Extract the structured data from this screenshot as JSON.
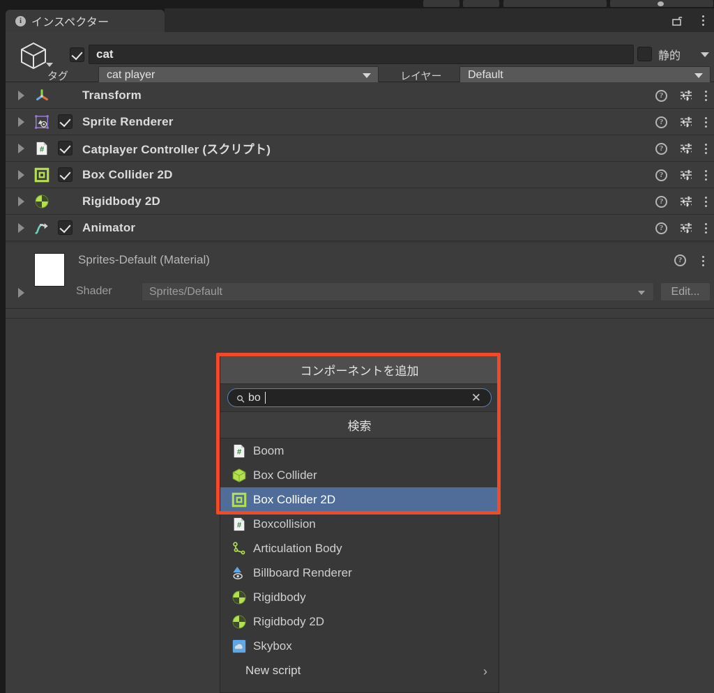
{
  "window": {
    "tab_label": "インスペクター",
    "tab_icon": "info-icon",
    "lock_icon": "lock-open-icon",
    "menu_icon": "kebab-menu-icon"
  },
  "game_object": {
    "enabled": true,
    "name": "cat",
    "icon": "cube-icon",
    "static_label": "静的",
    "static_checked": false,
    "tag_label": "タグ",
    "tag_value": "cat player",
    "layer_label": "レイヤー",
    "layer_value": "Default"
  },
  "components": [
    {
      "name": "Transform",
      "icon": "transform-axis-icon",
      "has_checkbox": false,
      "enabled": false
    },
    {
      "name": "Sprite Renderer",
      "icon": "sprite-renderer-icon",
      "has_checkbox": true,
      "enabled": true
    },
    {
      "name": "Catplayer Controller (スクリプト)",
      "icon": "cs-script-icon",
      "has_checkbox": true,
      "enabled": true
    },
    {
      "name": "Box Collider 2D",
      "icon": "box-collider-2d-icon",
      "has_checkbox": true,
      "enabled": true
    },
    {
      "name": "Rigidbody 2D",
      "icon": "rigidbody-2d-icon",
      "has_checkbox": false,
      "enabled": false
    },
    {
      "name": "Animator",
      "icon": "animator-icon",
      "has_checkbox": true,
      "enabled": true
    }
  ],
  "row_tools": {
    "help_label": "?",
    "help_icon": "help-icon",
    "settings_icon": "settings-sliders-icon",
    "menu_icon": "kebab-menu-icon"
  },
  "material": {
    "title": "Sprites-Default (Material)",
    "swatch_color": "#ffffff",
    "shader_label": "Shader",
    "shader_value": "Sprites/Default",
    "edit_label": "Edit..."
  },
  "add_component_popup": {
    "title": "コンポーネントを追加",
    "search_value": "bo",
    "search_placeholder": "",
    "search_icon": "magnifier-icon",
    "clear_icon": "clear-x-icon",
    "results_header": "検索",
    "results": [
      {
        "label": "Boom",
        "icon": "cs-script-icon",
        "selected": false
      },
      {
        "label": "Box Collider",
        "icon": "box-collider-icon",
        "selected": false
      },
      {
        "label": "Box Collider 2D",
        "icon": "box-collider-2d-icon",
        "selected": true
      },
      {
        "label": "Boxcollision",
        "icon": "cs-script-icon",
        "selected": false
      },
      {
        "label": "Articulation Body",
        "icon": "articulation-body-icon",
        "selected": false
      },
      {
        "label": "Billboard Renderer",
        "icon": "billboard-renderer-icon",
        "selected": false
      },
      {
        "label": "Rigidbody",
        "icon": "rigidbody-icon",
        "selected": false
      },
      {
        "label": "Rigidbody 2D",
        "icon": "rigidbody-2d-icon",
        "selected": false
      },
      {
        "label": "Skybox",
        "icon": "skybox-icon",
        "selected": false
      }
    ],
    "new_script_label": "New script",
    "new_script_arrow": "chevron-right-icon"
  },
  "annotation": {
    "highlight_color": "#f04a28"
  },
  "colors": {
    "panel_bg": "#3c3c3c",
    "window_bg": "#1b1b1b",
    "selection_blue": "#4f6d98",
    "unity_green": "#b4e050",
    "accent_border": "#5d82b5"
  }
}
